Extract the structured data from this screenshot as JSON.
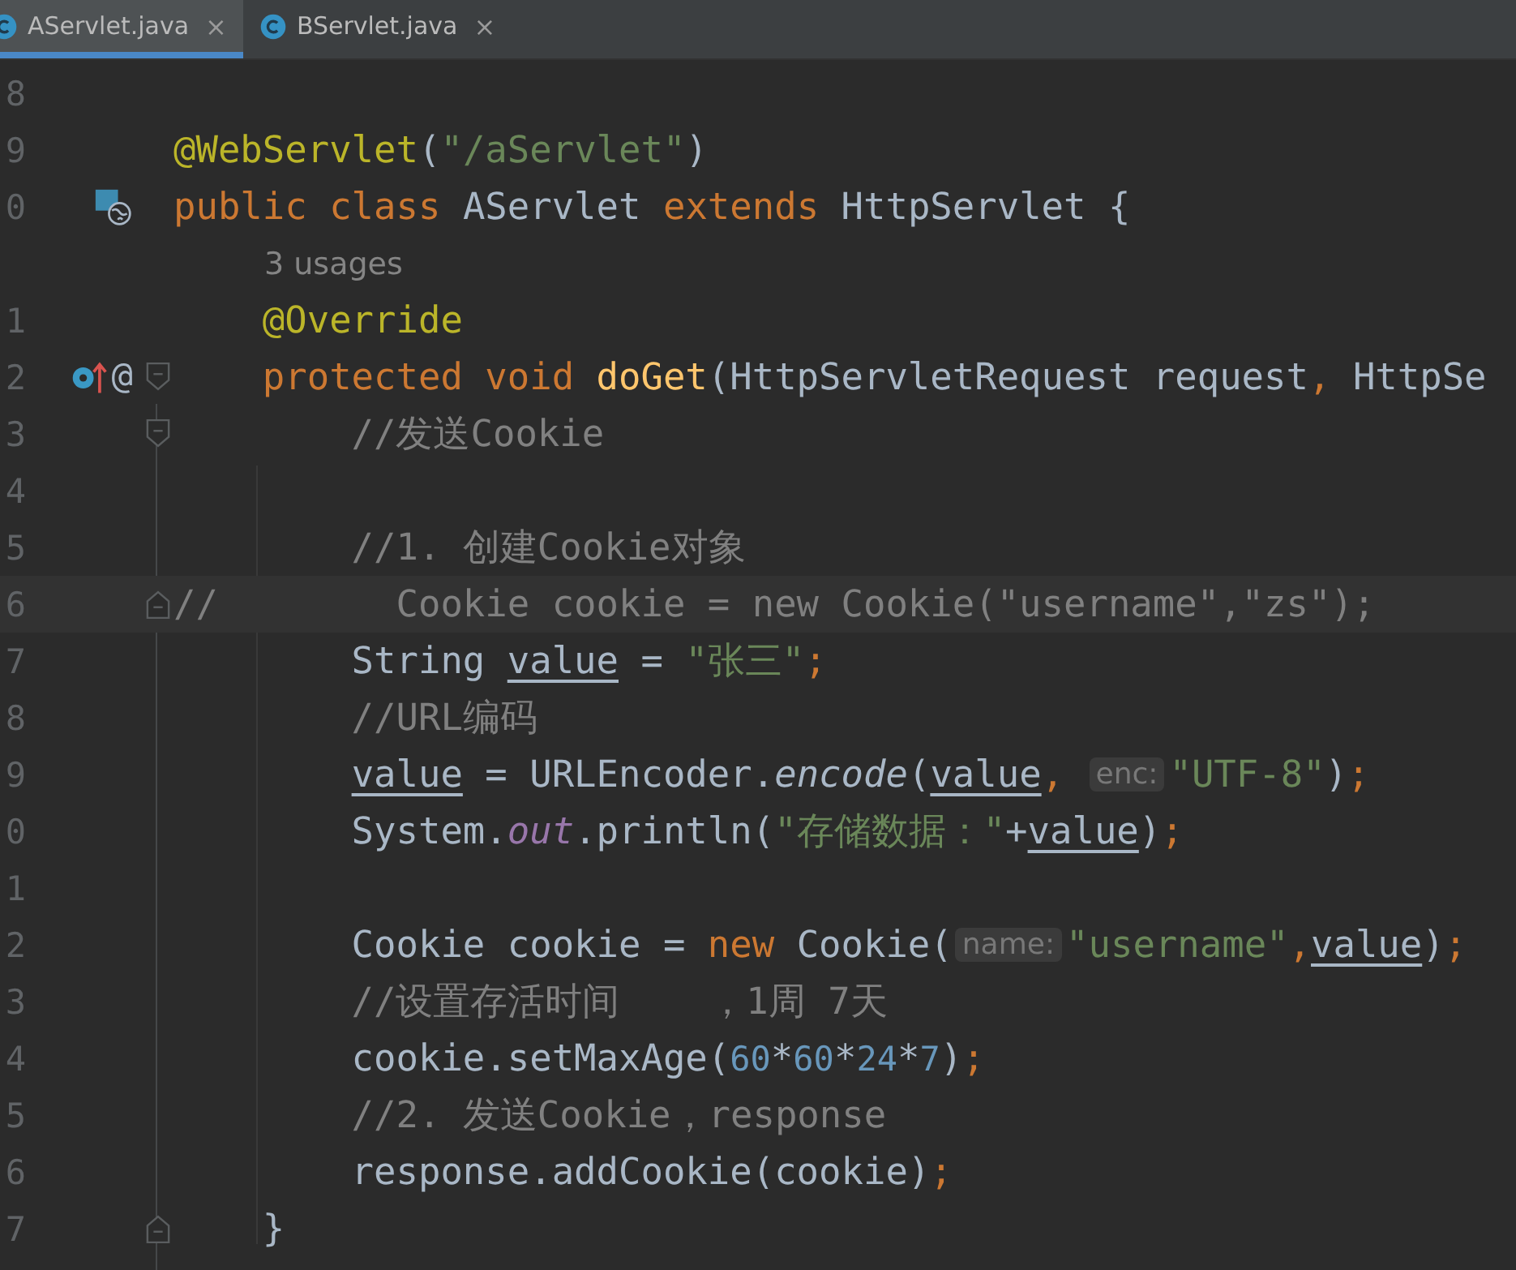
{
  "tabs": [
    {
      "label": "AServlet.java",
      "close": "×",
      "selected": true
    },
    {
      "label": "BServlet.java",
      "close": "×",
      "selected": false
    }
  ],
  "lines": [
    {
      "kind": "code",
      "number": "8"
    },
    {
      "kind": "code",
      "number": "9",
      "tokens": [
        {
          "t": "@WebServlet",
          "kind": "ann"
        },
        {
          "t": "(",
          "kind": "plain"
        },
        {
          "t": "\"/aServlet\"",
          "kind": "str"
        },
        {
          "t": ")",
          "kind": "plain"
        }
      ]
    },
    {
      "kind": "code",
      "number": "0",
      "gutter_icons": [
        {
          "kind": "servlet"
        }
      ],
      "tokens": [
        {
          "t": "public class ",
          "kind": "kw"
        },
        {
          "t": "AServlet ",
          "kind": "plain"
        },
        {
          "t": "extends ",
          "kind": "kw"
        },
        {
          "t": "HttpServlet {",
          "kind": "plain"
        }
      ]
    },
    {
      "kind": "usages",
      "text": "3 usages"
    },
    {
      "kind": "code",
      "number": "1",
      "tokens": [
        {
          "t": "    @Override",
          "kind": "ann"
        }
      ]
    },
    {
      "kind": "code",
      "number": "2",
      "gutter_icons": [
        {
          "kind": "override"
        }
      ],
      "gutter_mark": "@",
      "fold": {
        "kind": "start"
      },
      "tokens": [
        {
          "t": "    protected void ",
          "kind": "kw"
        },
        {
          "t": "doGet",
          "kind": "decl"
        },
        {
          "t": "(HttpServletRequest request",
          "kind": "plain"
        },
        {
          "t": ", ",
          "kind": "kw"
        },
        {
          "t": "HttpSe",
          "kind": "plain"
        }
      ]
    },
    {
      "kind": "code",
      "number": "3",
      "fold": {
        "kind": "start"
      },
      "tokens": [
        {
          "t": "        //发送Cookie",
          "kind": "cmt"
        }
      ]
    },
    {
      "kind": "code",
      "number": "4"
    },
    {
      "kind": "code",
      "number": "5",
      "tokens": [
        {
          "t": "        //1. 创建Cookie对象",
          "kind": "cmt"
        }
      ]
    },
    {
      "kind": "code",
      "number": "6",
      "current": true,
      "fold": {
        "kind": "end"
      },
      "tokens": [
        {
          "t": "//        Cookie cookie = new Cookie(\"username\",\"zs\");",
          "kind": "cmt"
        }
      ]
    },
    {
      "kind": "code",
      "number": "7",
      "tokens": [
        {
          "t": "        String ",
          "kind": "plain"
        },
        {
          "t": "value",
          "kind": "var"
        },
        {
          "t": " = ",
          "kind": "plain"
        },
        {
          "t": "\"张三\"",
          "kind": "str"
        },
        {
          "t": ";",
          "kind": "kw"
        }
      ]
    },
    {
      "kind": "code",
      "number": "8",
      "tokens": [
        {
          "t": "        //URL编码",
          "kind": "cmt"
        }
      ]
    },
    {
      "kind": "code",
      "number": "9",
      "tokens": [
        {
          "t": "        value",
          "kind": "var"
        },
        {
          "t": " = URLEncoder.",
          "kind": "plain"
        },
        {
          "t": "encode",
          "kind": "static"
        },
        {
          "t": "(",
          "kind": "plain"
        },
        {
          "t": "value",
          "kind": "var"
        },
        {
          "t": ", ",
          "kind": "kw"
        },
        {
          "t": "enc:",
          "kind": "hint"
        },
        {
          "t": "\"UTF-8\"",
          "kind": "str"
        },
        {
          "t": ")",
          "kind": "plain"
        },
        {
          "t": ";",
          "kind": "kw"
        }
      ]
    },
    {
      "kind": "code",
      "number": "0",
      "tokens": [
        {
          "t": "        System.",
          "kind": "plain"
        },
        {
          "t": "out",
          "kind": "field"
        },
        {
          "t": ".println(",
          "kind": "plain"
        },
        {
          "t": "\"存储数据：\"",
          "kind": "str"
        },
        {
          "t": "+",
          "kind": "plain"
        },
        {
          "t": "value",
          "kind": "var"
        },
        {
          "t": ")",
          "kind": "plain"
        },
        {
          "t": ";",
          "kind": "kw"
        }
      ]
    },
    {
      "kind": "code",
      "number": "1"
    },
    {
      "kind": "code",
      "number": "2",
      "tokens": [
        {
          "t": "        Cookie cookie = ",
          "kind": "plain"
        },
        {
          "t": "new ",
          "kind": "kw"
        },
        {
          "t": "Cookie(",
          "kind": "plain"
        },
        {
          "t": "name:",
          "kind": "hint"
        },
        {
          "t": "\"username\"",
          "kind": "str"
        },
        {
          "t": ",",
          "kind": "kw"
        },
        {
          "t": "value",
          "kind": "var"
        },
        {
          "t": ")",
          "kind": "plain"
        },
        {
          "t": ";",
          "kind": "kw"
        }
      ]
    },
    {
      "kind": "code",
      "number": "3",
      "tokens": [
        {
          "t": "        //设置存活时间    ，1周 7天",
          "kind": "cmt"
        }
      ]
    },
    {
      "kind": "code",
      "number": "4",
      "tokens": [
        {
          "t": "        cookie.setMaxAge(",
          "kind": "plain"
        },
        {
          "t": "60",
          "kind": "num"
        },
        {
          "t": "*",
          "kind": "plain"
        },
        {
          "t": "60",
          "kind": "num"
        },
        {
          "t": "*",
          "kind": "plain"
        },
        {
          "t": "24",
          "kind": "num"
        },
        {
          "t": "*",
          "kind": "plain"
        },
        {
          "t": "7",
          "kind": "num"
        },
        {
          "t": ")",
          "kind": "plain"
        },
        {
          "t": ";",
          "kind": "kw"
        }
      ]
    },
    {
      "kind": "code",
      "number": "5",
      "tokens": [
        {
          "t": "        //2. 发送Cookie，response",
          "kind": "cmt"
        }
      ]
    },
    {
      "kind": "code",
      "number": "6",
      "tokens": [
        {
          "t": "        response.addCookie(cookie)",
          "kind": "plain"
        },
        {
          "t": ";",
          "kind": "kw"
        }
      ]
    },
    {
      "kind": "code",
      "number": "7",
      "fold": {
        "kind": "end"
      },
      "tokens": [
        {
          "t": "    }",
          "kind": "plain"
        }
      ]
    }
  ]
}
